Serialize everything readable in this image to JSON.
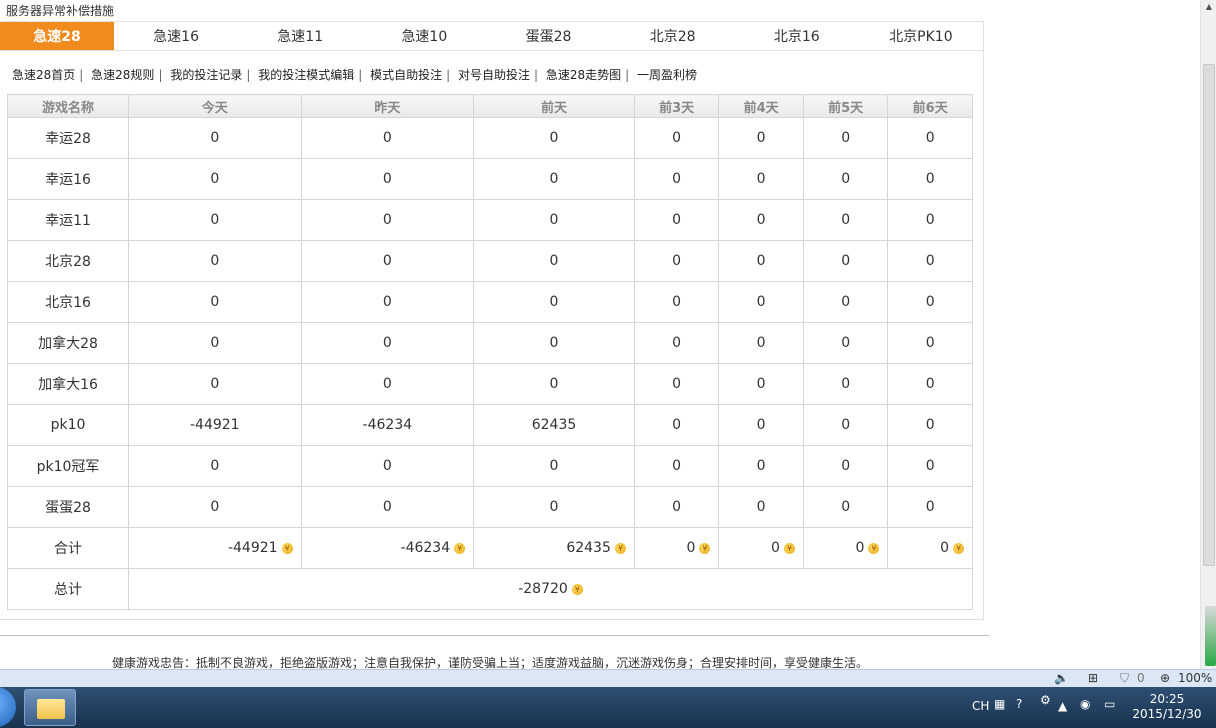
{
  "top_link": "服务器异常补偿措施",
  "tabs": [
    "急速28",
    "急速16",
    "急速11",
    "急速10",
    "蛋蛋28",
    "北京28",
    "北京16",
    "北京PK10"
  ],
  "subnav": [
    "急速28首页",
    "急速28规则",
    "我的投注记录",
    "我的投注模式编辑",
    "模式自助投注",
    "对号自助投注",
    "急速28走势图",
    "一周盈利榜"
  ],
  "table": {
    "headers": [
      "游戏名称",
      "今天",
      "昨天",
      "前天",
      "前3天",
      "前4天",
      "前5天",
      "前6天"
    ],
    "rows": [
      {
        "name": "幸运28",
        "values": [
          "0",
          "0",
          "0",
          "0",
          "0",
          "0",
          "0"
        ]
      },
      {
        "name": "幸运16",
        "values": [
          "0",
          "0",
          "0",
          "0",
          "0",
          "0",
          "0"
        ]
      },
      {
        "name": "幸运11",
        "values": [
          "0",
          "0",
          "0",
          "0",
          "0",
          "0",
          "0"
        ]
      },
      {
        "name": "北京28",
        "values": [
          "0",
          "0",
          "0",
          "0",
          "0",
          "0",
          "0"
        ]
      },
      {
        "name": "北京16",
        "values": [
          "0",
          "0",
          "0",
          "0",
          "0",
          "0",
          "0"
        ]
      },
      {
        "name": "加拿大28",
        "values": [
          "0",
          "0",
          "0",
          "0",
          "0",
          "0",
          "0"
        ]
      },
      {
        "name": "加拿大16",
        "values": [
          "0",
          "0",
          "0",
          "0",
          "0",
          "0",
          "0"
        ]
      },
      {
        "name": "pk10",
        "values": [
          "-44921",
          "-46234",
          "62435",
          "0",
          "0",
          "0",
          "0"
        ]
      },
      {
        "name": "pk10冠军",
        "values": [
          "0",
          "0",
          "0",
          "0",
          "0",
          "0",
          "0"
        ]
      },
      {
        "name": "蛋蛋28",
        "values": [
          "0",
          "0",
          "0",
          "0",
          "0",
          "0",
          "0"
        ]
      }
    ],
    "sum_label": "合计",
    "sums": [
      "-44921",
      "-46234",
      "62435",
      "0",
      "0",
      "0",
      "0"
    ],
    "total_label": "总计",
    "total": "-28720",
    "coin_glyph": "¥"
  },
  "footer_note": "健康游戏忠告：抵制不良游戏，拒绝盗版游戏；注意自我保护，谨防受骗上当；适度游戏益脑，沉迷游戏伤身；合理安排时间，享受健康生活。",
  "statusbar": {
    "zoom": "100%",
    "count": "0"
  },
  "taskbar": {
    "lang": "CH",
    "time": "20:25",
    "date": "2015/12/30"
  },
  "colors": {
    "accent": "#f28b1e",
    "negative_text": "#f06a0f"
  }
}
